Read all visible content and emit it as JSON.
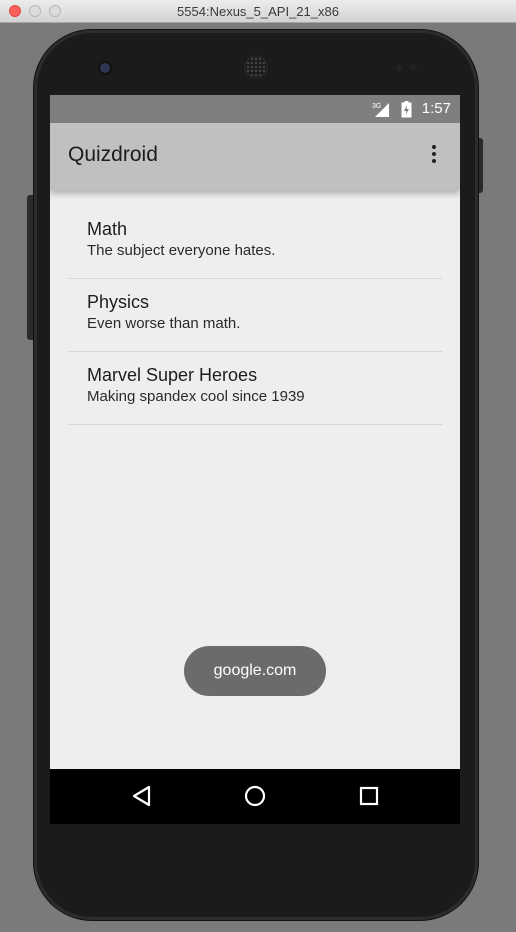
{
  "window": {
    "title": "5554:Nexus_5_API_21_x86"
  },
  "status_bar": {
    "time": "1:57",
    "network": "3G"
  },
  "app_bar": {
    "title": "Quizdroid",
    "menu_icon": "more-vert-icon"
  },
  "topics": [
    {
      "title": "Math",
      "description": "The subject everyone hates."
    },
    {
      "title": "Physics",
      "description": "Even worse than math."
    },
    {
      "title": "Marvel Super Heroes",
      "description": "Making spandex cool since 1939"
    }
  ],
  "toast": {
    "text": "google.com"
  },
  "nav_bar": {
    "back_icon": "back-triangle-icon",
    "home_icon": "home-circle-icon",
    "recents_icon": "recents-square-icon"
  },
  "colors": {
    "app_bar": "#c0c0c0",
    "status_bar": "#7f7f7f",
    "background": "#eeeeee",
    "toast": "#6b6b6b"
  }
}
